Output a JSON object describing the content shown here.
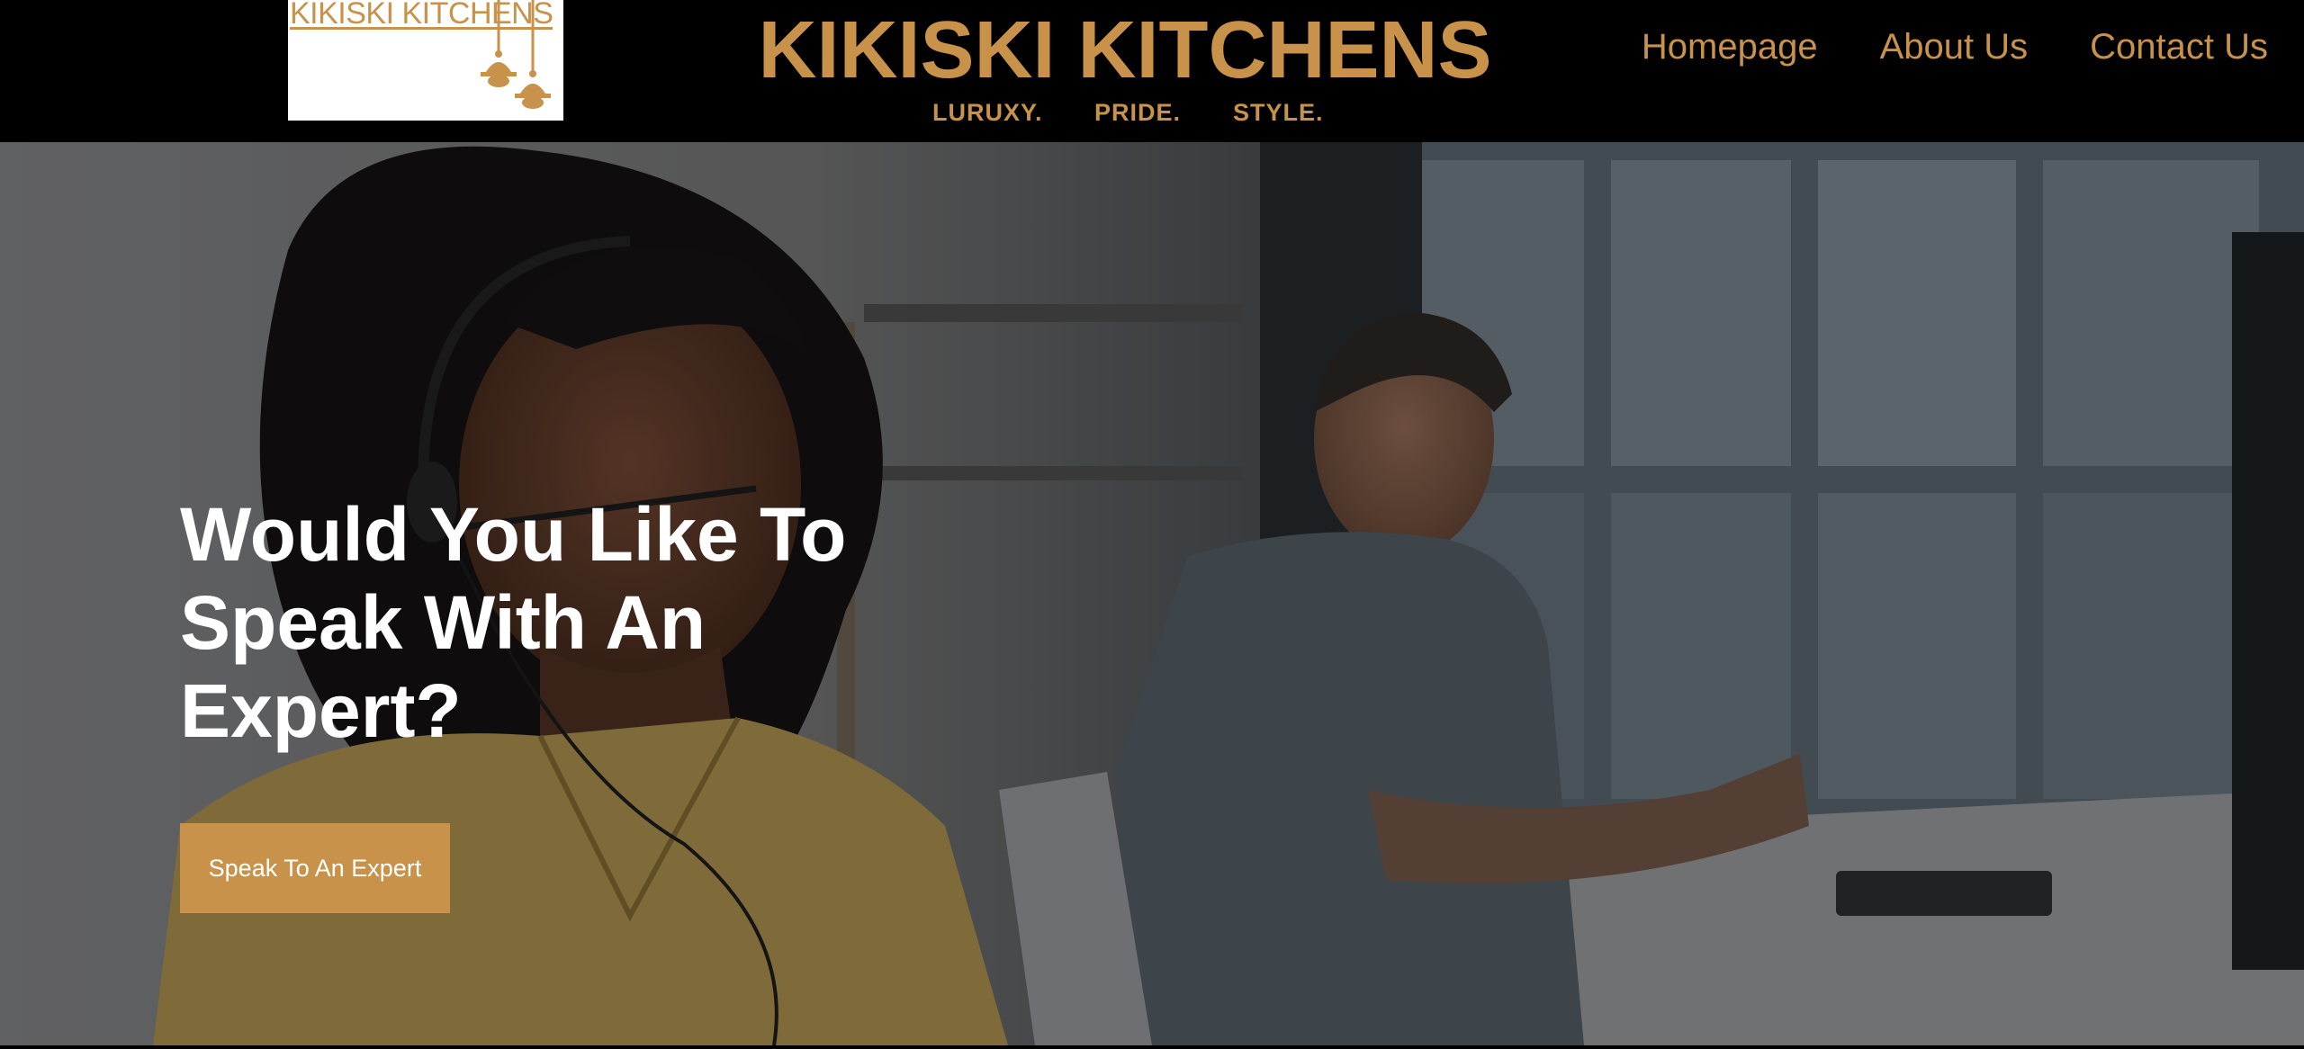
{
  "header": {
    "logo": {
      "text": "KIKISKI KITCHENS",
      "icon": "pendant-lamps-icon"
    },
    "brand_title": "KIKISKI KITCHENS",
    "taglines": [
      "LURUXY.",
      "PRIDE.",
      "STYLE."
    ],
    "nav": [
      {
        "label": "Homepage"
      },
      {
        "label": "About Us"
      },
      {
        "label": "Contact Us"
      }
    ]
  },
  "hero": {
    "heading": "Would You Like To Speak With An Expert?",
    "cta_label": "Speak To An Expert",
    "image": "call-center-agents-photo"
  },
  "colors": {
    "accent": "#c8924a",
    "header_bg": "#000000",
    "heading_text": "#ffffff"
  }
}
